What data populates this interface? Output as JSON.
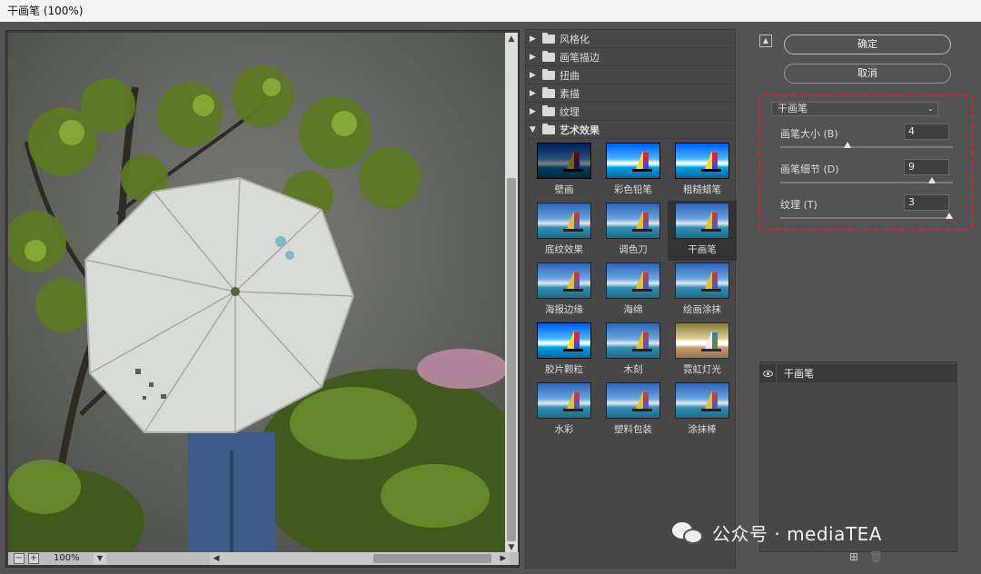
{
  "window": {
    "title": "干画笔 (100%)"
  },
  "preview": {
    "zoom": "100%"
  },
  "gallery": {
    "categories": [
      {
        "label": "风格化",
        "open": false
      },
      {
        "label": "画笔描边",
        "open": false
      },
      {
        "label": "扭曲",
        "open": false
      },
      {
        "label": "素描",
        "open": false
      },
      {
        "label": "纹理",
        "open": false
      },
      {
        "label": "艺术效果",
        "open": true
      }
    ],
    "filters": [
      {
        "label": "壁画"
      },
      {
        "label": "彩色铅笔"
      },
      {
        "label": "粗糙蜡笔"
      },
      {
        "label": "底纹效果"
      },
      {
        "label": "调色刀"
      },
      {
        "label": "干画笔",
        "selected": true
      },
      {
        "label": "海报边缘"
      },
      {
        "label": "海绵"
      },
      {
        "label": "绘画涂抹"
      },
      {
        "label": "胶片颗粒"
      },
      {
        "label": "木刻"
      },
      {
        "label": "霓虹灯光"
      },
      {
        "label": "水彩"
      },
      {
        "label": "塑料包装"
      },
      {
        "label": "涂抹棒"
      }
    ]
  },
  "controls": {
    "ok_label": "确定",
    "cancel_label": "取消",
    "filter_select": "干画笔",
    "params": [
      {
        "label": "画笔大小 (B)",
        "value": "4",
        "fraction": 0.4
      },
      {
        "label": "画笔细节 (D)",
        "value": "9",
        "fraction": 0.9
      },
      {
        "label": "纹理 (T)",
        "value": "3",
        "fraction": 1.0
      }
    ]
  },
  "layers": {
    "items": [
      {
        "label": "干画笔"
      }
    ]
  },
  "watermark": {
    "text": "公众号 · mediaTEA"
  }
}
